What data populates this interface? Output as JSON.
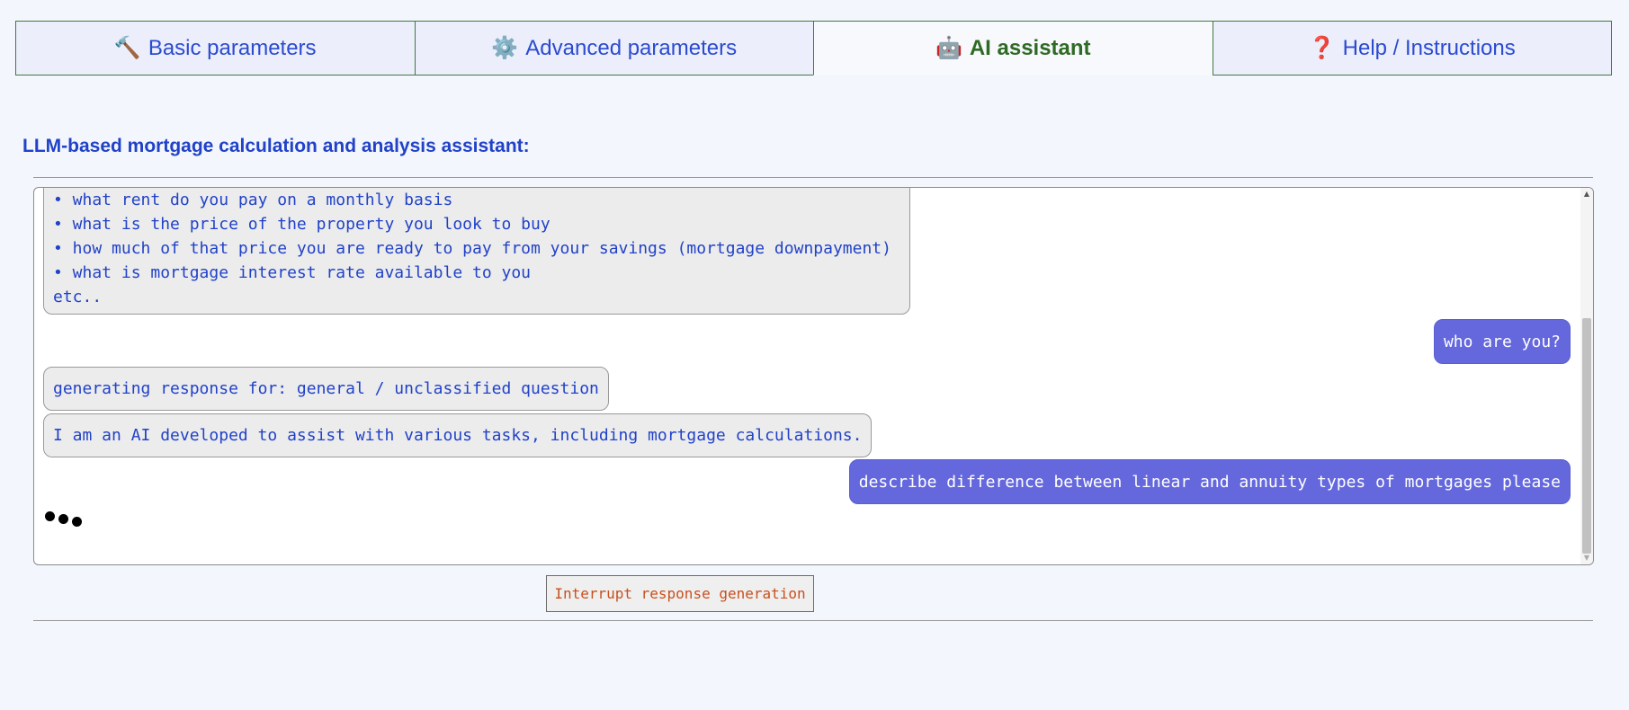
{
  "tabs": [
    {
      "icon": "🔨",
      "label": "Basic parameters"
    },
    {
      "icon": "⚙️",
      "label": "Advanced parameters"
    },
    {
      "icon": "🤖",
      "label": "AI assistant"
    },
    {
      "icon": "❓",
      "label": "Help / Instructions"
    }
  ],
  "active_tab": "AI assistant",
  "heading": "LLM-based mortgage calculation and analysis assistant:",
  "chat": {
    "first_bot_message": "• what rent do you pay on a monthly basis\n• what is the price of the property you look to buy\n• how much of that price you are ready to pay from your savings (mortgage downpayment)\n• what is mortgage interest rate available to you\netc..",
    "user_message_1": "who are you?",
    "status_message": "generating response for: general / unclassified question",
    "bot_answer": "I am an AI developed to assist with various tasks, including mortgage calculations.",
    "user_message_2": "describe difference between linear and annuity types of mortgages please",
    "typing_indicator": "typing-dots-icon"
  },
  "interrupt_button": "Interrupt response generation",
  "colors": {
    "page_bg": "#f3f6fc",
    "accent_blue": "#2142c8",
    "active_tab_green": "#2f6a24",
    "user_bubble": "#6468dc",
    "interrupt_text": "#c8501e"
  }
}
